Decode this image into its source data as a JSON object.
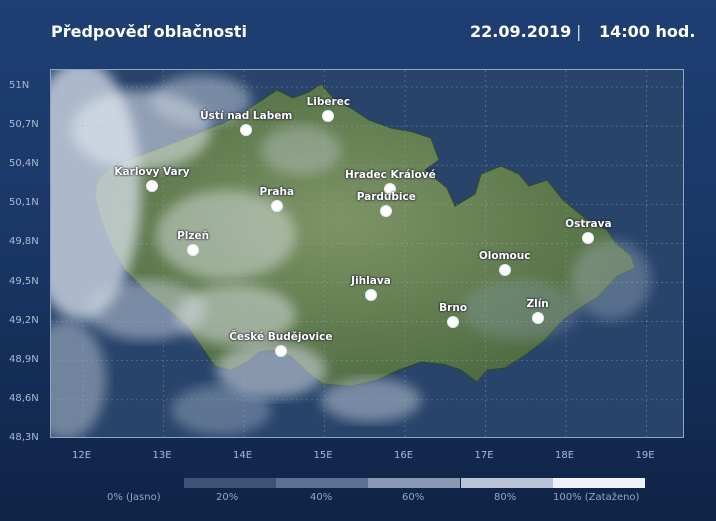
{
  "header": {
    "title": "Předpověď oblačnosti",
    "date": "22.09.2019",
    "separator": "|",
    "time": "14:00 hod."
  },
  "axes": {
    "lat_labels": [
      "51N",
      "50,7N",
      "50,4N",
      "50,1N",
      "49,8N",
      "49,5N",
      "49,2N",
      "48,9N",
      "48,6N",
      "48,3N"
    ],
    "lon_labels": [
      "12E",
      "13E",
      "14E",
      "15E",
      "16E",
      "17E",
      "18E",
      "19E"
    ],
    "lat_range": [
      48.3,
      51.0
    ],
    "lon_range": [
      11.5,
      19.5
    ],
    "grid": true
  },
  "cities": [
    {
      "name": "Ústí nad Labem",
      "lon": 14.04,
      "lat": 50.66
    },
    {
      "name": "Liberec",
      "lon": 15.06,
      "lat": 50.77
    },
    {
      "name": "Karlovy Vary",
      "lon": 12.87,
      "lat": 50.23
    },
    {
      "name": "Hradec Králové",
      "lon": 15.83,
      "lat": 50.21
    },
    {
      "name": "Praha",
      "lon": 14.42,
      "lat": 50.08
    },
    {
      "name": "Pardubice",
      "lon": 15.78,
      "lat": 50.04
    },
    {
      "name": "Ostrava",
      "lon": 18.29,
      "lat": 49.83
    },
    {
      "name": "Plzeň",
      "lon": 13.38,
      "lat": 49.74
    },
    {
      "name": "Olomouc",
      "lon": 17.25,
      "lat": 49.59
    },
    {
      "name": "Jihlava",
      "lon": 15.59,
      "lat": 49.4
    },
    {
      "name": "Zlín",
      "lon": 17.66,
      "lat": 49.22
    },
    {
      "name": "Brno",
      "lon": 16.61,
      "lat": 49.19
    },
    {
      "name": "České Budějovice",
      "lon": 14.47,
      "lat": 48.97
    }
  ],
  "legend": {
    "labels": [
      "0% (Jasno)",
      "20%",
      "40%",
      "60%",
      "80%",
      "100% (Zataženo)"
    ],
    "colors": [
      "#3d5275",
      "#5b7093",
      "#8798b3",
      "#b8c3d5",
      "#eef2f8"
    ]
  }
}
